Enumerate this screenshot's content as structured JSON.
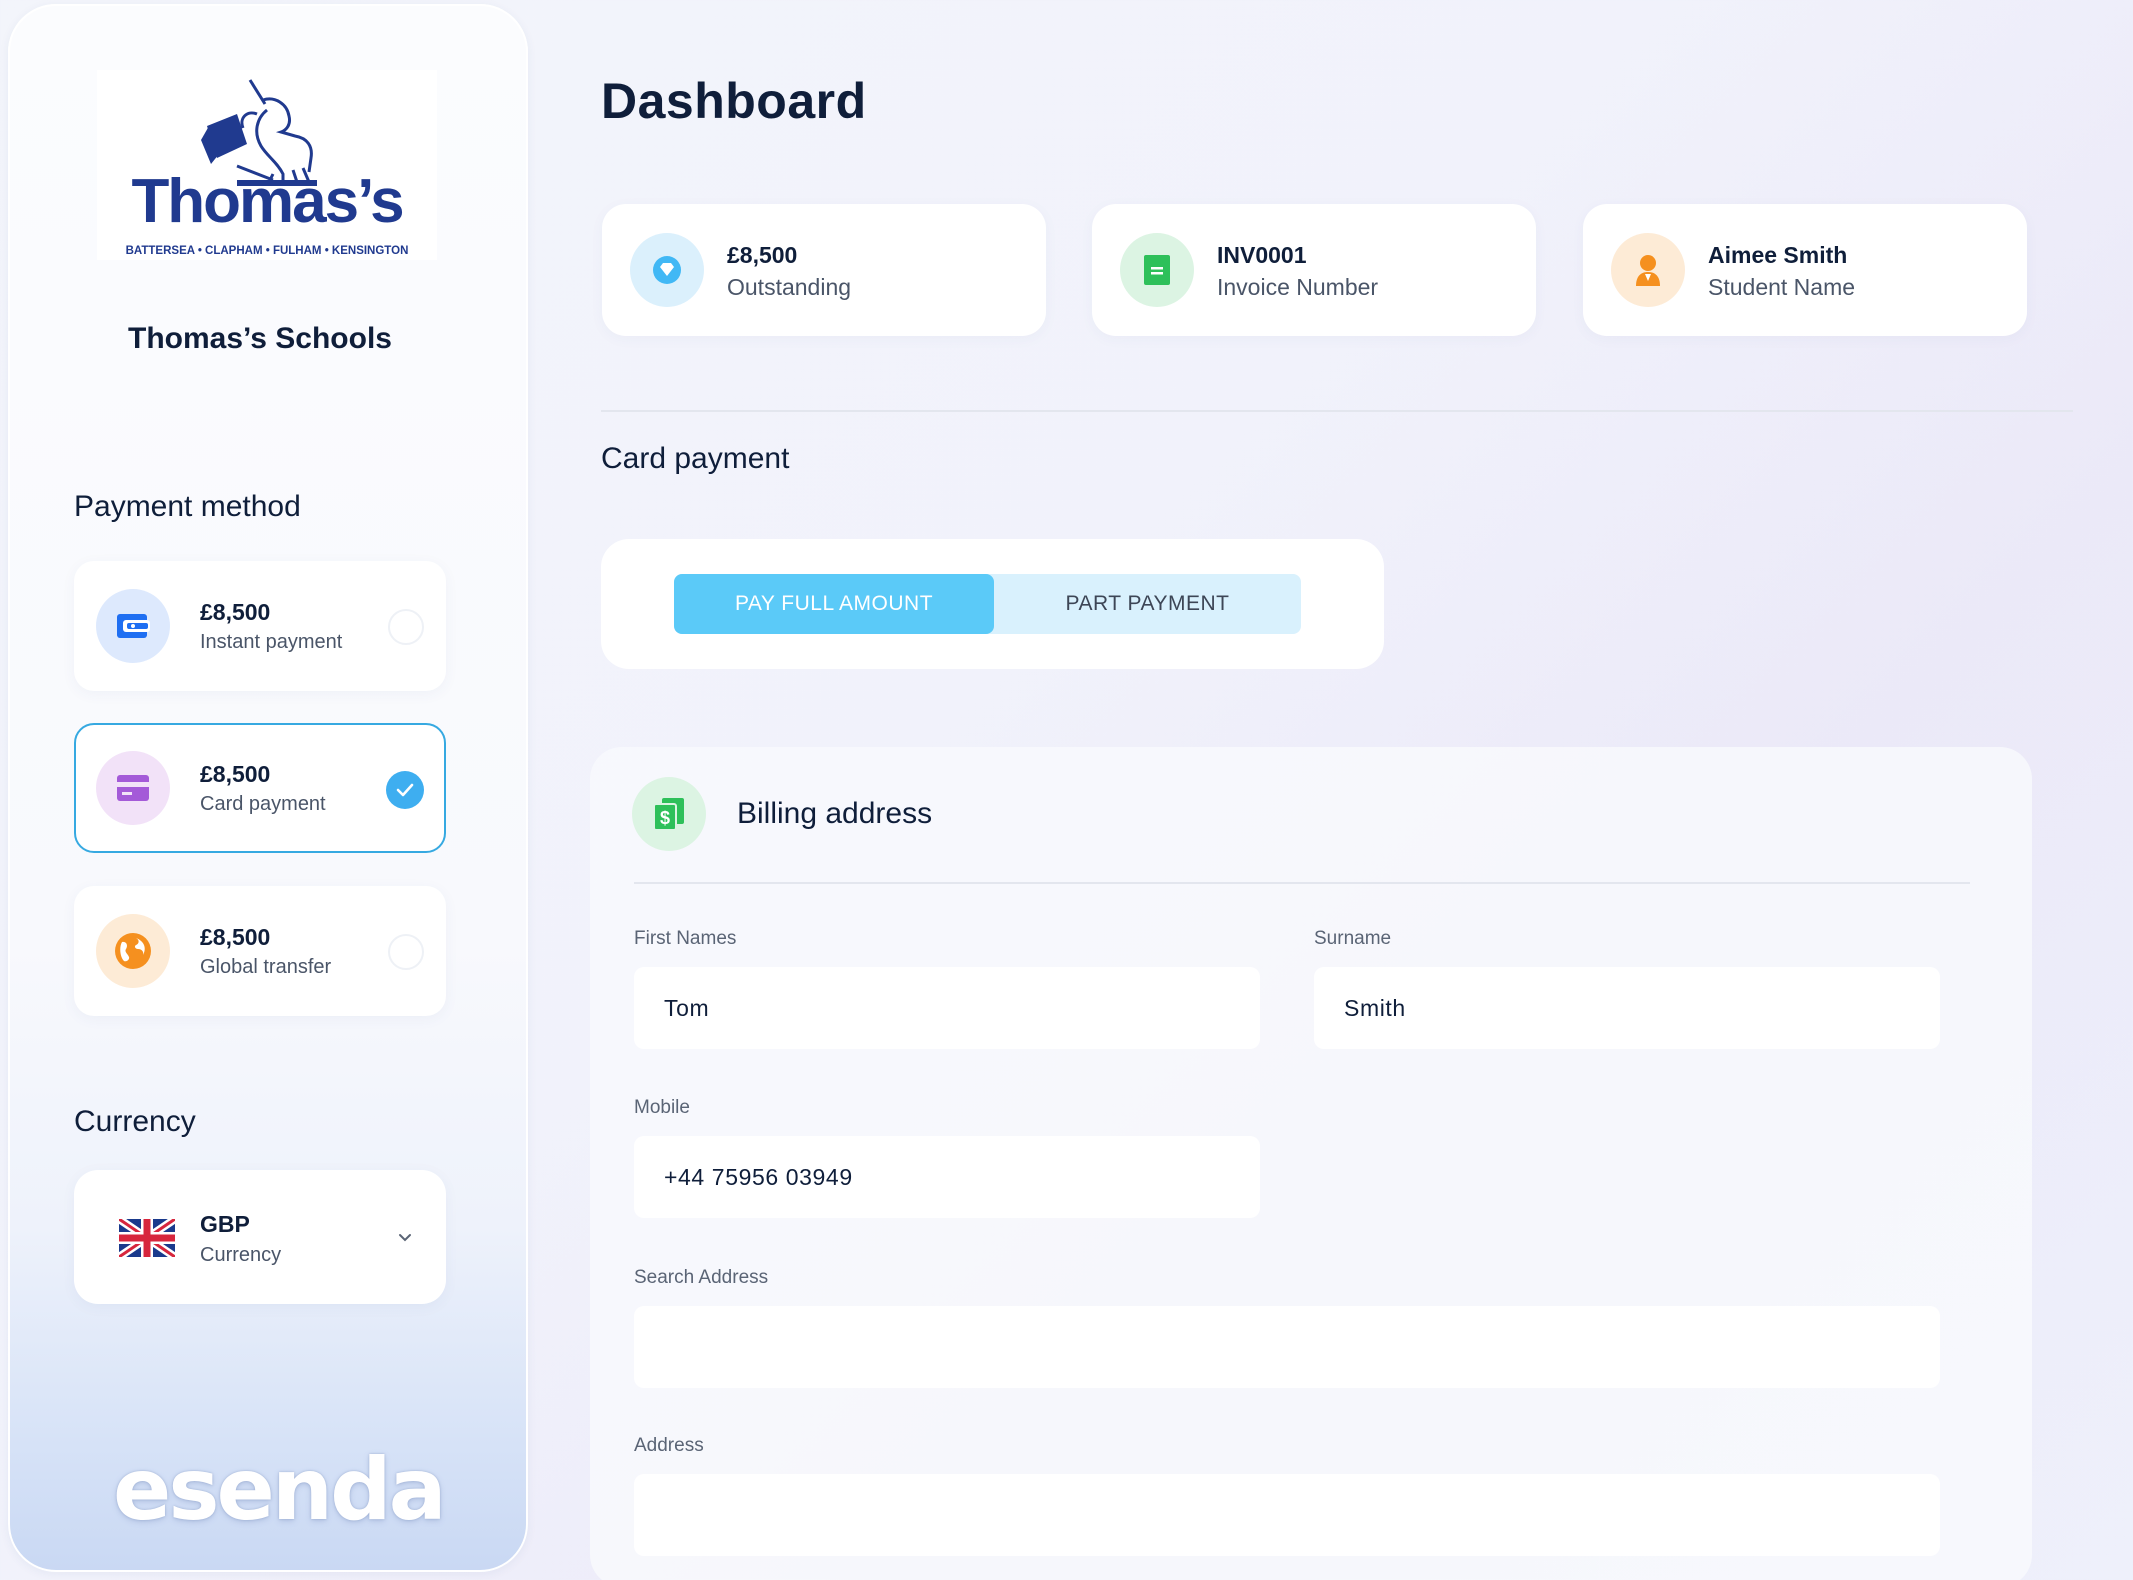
{
  "sidebar": {
    "logo": {
      "wordmark": "Thomas’s",
      "tagline": "BATTERSEA • CLAPHAM • FULHAM • KENSINGTON"
    },
    "school_name": "Thomas’s Schools",
    "payment_method_heading": "Payment method",
    "payment_methods": [
      {
        "amount": "£8,500",
        "label": "Instant payment",
        "icon": "wallet-icon",
        "color": "#1f6ff2",
        "selected": false
      },
      {
        "amount": "£8,500",
        "label": "Card payment",
        "icon": "credit-card-icon",
        "color": "#a45ad8",
        "selected": true
      },
      {
        "amount": "£8,500",
        "label": "Global transfer",
        "icon": "globe-icon",
        "color": "#f5901f",
        "selected": false
      }
    ],
    "currency_heading": "Currency",
    "currency": {
      "code": "GBP",
      "label": "Currency",
      "flag": "uk-flag-icon"
    },
    "brand": "esenda"
  },
  "main": {
    "title": "Dashboard",
    "stats": [
      {
        "value": "£8,500",
        "label": "Outstanding",
        "icon": "diamond-icon",
        "color": "#41b8f5"
      },
      {
        "value": "INV0001",
        "label": "Invoice Number",
        "icon": "document-icon",
        "color": "#2ec05a"
      },
      {
        "value": "Aimee Smith",
        "label": "Student Name",
        "icon": "person-icon",
        "color": "#f5901f"
      }
    ],
    "section_title": "Card payment",
    "payment_toggle": {
      "full": "PAY FULL AMOUNT",
      "part": "PART PAYMENT",
      "active": "full"
    },
    "billing": {
      "title": "Billing address",
      "first_names": {
        "label": "First Names",
        "value": "Tom"
      },
      "surname": {
        "label": "Surname",
        "value": "Smith"
      },
      "mobile": {
        "label": "Mobile",
        "value": "+44 75956 03949"
      },
      "search_address": {
        "label": "Search Address",
        "value": ""
      },
      "address": {
        "label": "Address",
        "value": ""
      }
    }
  },
  "colors": {
    "accent": "#3eaef0",
    "toggle_active": "#5bcaf8",
    "toggle_track": "#d9f1fd",
    "navy": "#0f1e3a"
  }
}
